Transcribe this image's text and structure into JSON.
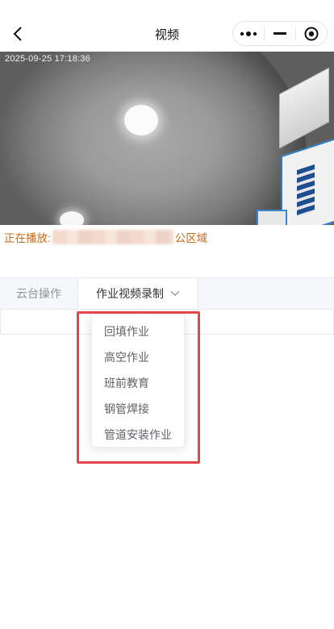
{
  "navbar": {
    "title": "视频",
    "icons": {
      "back": "chevron-left-icon",
      "more": "more-dots-icon",
      "minimize": "minimize-icon",
      "close": "target-circle-icon"
    }
  },
  "video": {
    "timestamp": "2025-09-25 17:18:36"
  },
  "playing": {
    "prefix": "正在播放:",
    "suffix": "公区域"
  },
  "tabs": [
    {
      "label": "云台操作"
    },
    {
      "label": "作业视频录制"
    }
  ],
  "dropdown": {
    "items": [
      "回填作业",
      "高空作业",
      "班前教育",
      "钢管焊接",
      "管道安装作业"
    ]
  },
  "colors": {
    "accent_orange": "#c66a1e",
    "highlight_red": "#e8454a",
    "tab_bg": "#f5f7fa",
    "text_gray": "#606266"
  }
}
